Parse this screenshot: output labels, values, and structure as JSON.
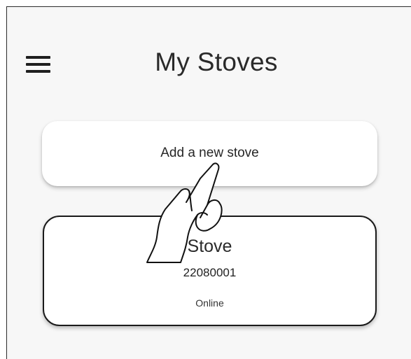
{
  "header": {
    "menu_icon": "hamburger-menu-icon",
    "title": "My Stoves"
  },
  "add_card": {
    "label": "Add a new stove"
  },
  "stoves": [
    {
      "name": "Stove",
      "serial": "22080001",
      "status": "Online"
    }
  ],
  "overlay": {
    "gesture_icon": "tap-hand-icon"
  },
  "colors": {
    "background": "#f7f7f7",
    "card": "#ffffff",
    "text": "#2a2a2a",
    "card_border": "#1a1a1a"
  }
}
